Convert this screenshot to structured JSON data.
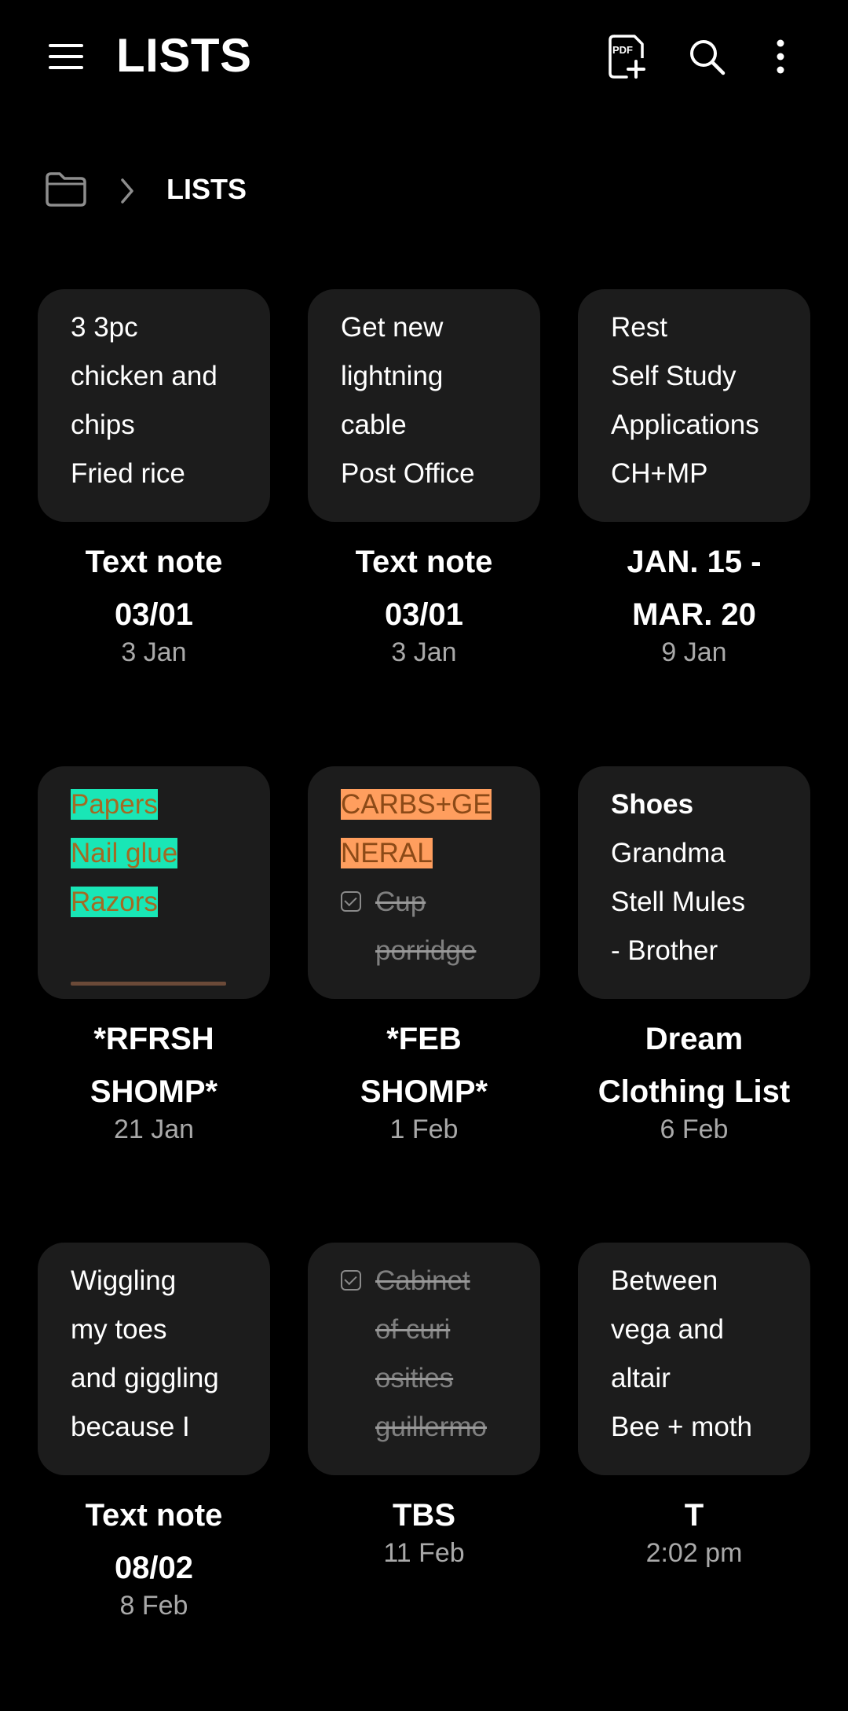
{
  "header": {
    "title": "LISTS",
    "pdf_icon_text": "PDF"
  },
  "breadcrumb": {
    "label": "LISTS"
  },
  "notes": [
    {
      "preview": [
        "3 3pc",
        "chicken and",
        "chips",
        "Fried rice"
      ],
      "title": [
        "Text note",
        "03/01"
      ],
      "date": "3 Jan"
    },
    {
      "preview": [
        "Get new",
        "lightning",
        "cable",
        "Post Office"
      ],
      "title": [
        "Text note",
        "03/01"
      ],
      "date": "3 Jan"
    },
    {
      "preview": [
        "Rest",
        "Self Study",
        "Applications",
        "CH+MP"
      ],
      "title": [
        "JAN. 15 -",
        "MAR. 20"
      ],
      "date": "9 Jan"
    },
    {
      "preview": [
        "Papers",
        "Nail glue",
        "Razors"
      ],
      "highlight_color": "#19e6b6",
      "title": [
        "*RFRSH",
        "SHOMP*"
      ],
      "date": "21 Jan"
    },
    {
      "preview": [
        "CARBS+GE",
        "NERAL",
        "Cup",
        "porridge"
      ],
      "highlight_color": "#ff9e5e",
      "title": [
        "*FEB",
        "SHOMP*"
      ],
      "date": "1 Feb"
    },
    {
      "preview": [
        "Shoes",
        "Grandma",
        "Stell Mules",
        "- Brother"
      ],
      "title": [
        "Dream",
        "Clothing List"
      ],
      "date": "6 Feb"
    },
    {
      "preview": [
        "Wiggling",
        "my toes",
        "and giggling",
        "because I"
      ],
      "title": [
        "Text note",
        "08/02"
      ],
      "date": "8 Feb"
    },
    {
      "preview": [
        "Cabinet",
        "of curi",
        "osities",
        "guillermo"
      ],
      "title": [
        "TBS"
      ],
      "date": "11 Feb"
    },
    {
      "preview": [
        "Between",
        "vega and",
        "altair",
        "Bee + moth"
      ],
      "title": [
        "T"
      ],
      "date": "2:02 pm"
    }
  ]
}
